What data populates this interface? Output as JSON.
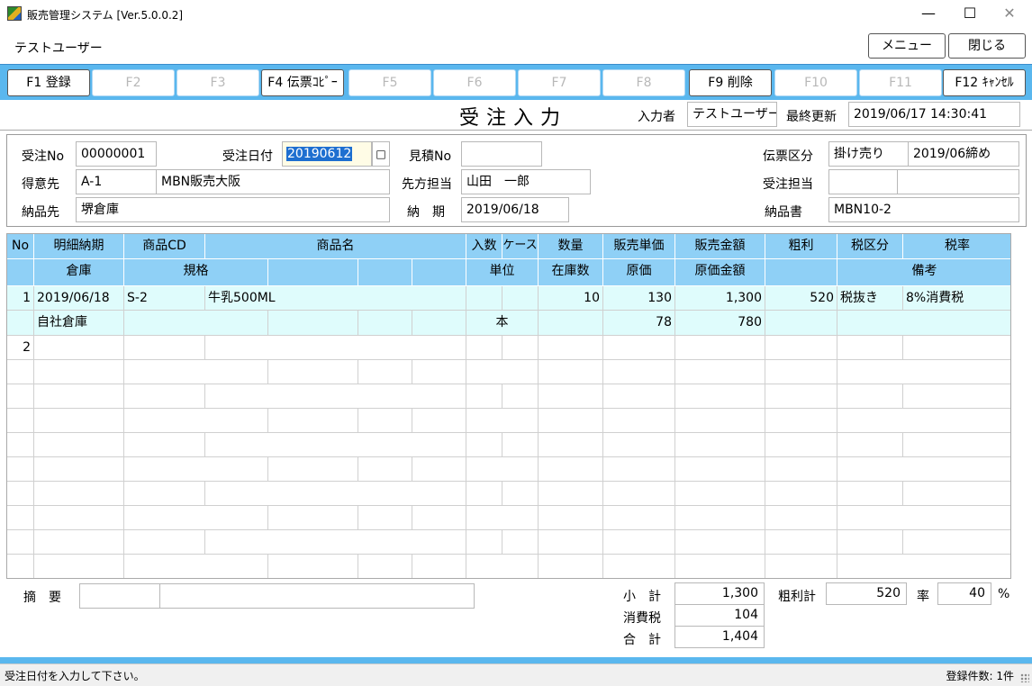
{
  "window": {
    "title": "販売管理システム [Ver.5.0.0.2]",
    "min": "—",
    "max": "☐",
    "close": "✕"
  },
  "user": "テストユーザー",
  "top_buttons": {
    "menu": "メニュー",
    "close": "閉じる"
  },
  "fkeys": [
    {
      "label": "F1 登録",
      "enabled": true
    },
    {
      "label": "F2",
      "enabled": false
    },
    {
      "label": "F3",
      "enabled": false
    },
    {
      "label": "F4 伝票ｺﾋﾟｰ",
      "enabled": true
    },
    {
      "label": "F5",
      "enabled": false
    },
    {
      "label": "F6",
      "enabled": false
    },
    {
      "label": "F7",
      "enabled": false
    },
    {
      "label": "F8",
      "enabled": false
    },
    {
      "label": "F9 削除",
      "enabled": true
    },
    {
      "label": "F10",
      "enabled": false
    },
    {
      "label": "F11",
      "enabled": false
    },
    {
      "label": "F12 ｷｬﾝｾﾙ",
      "enabled": true
    }
  ],
  "form": {
    "title": "受注入力",
    "inputter_label": "入力者",
    "inputter": "テストユーザー",
    "updated_label": "最終更新",
    "updated": "2019/06/17 14:30:41"
  },
  "header": {
    "order_no_label": "受注No",
    "order_no": "00000001",
    "order_date_label": "受注日付",
    "order_date": "20190612",
    "date_btn": "□",
    "quote_no_label": "見積No",
    "quote_no": "",
    "slip_type_label": "伝票区分",
    "slip_type": "掛け売り",
    "closing": "2019/06締め",
    "customer_label": "得意先",
    "customer_code": "A-1",
    "customer_name": "MBN販売大阪",
    "contact_label": "先方担当",
    "contact": "山田　一郎",
    "staff_label": "受注担当",
    "staff_code": "",
    "staff_name": "",
    "delivery_label": "納品先",
    "delivery": "堺倉庫",
    "due_label": "納　期",
    "due": "2019/06/18",
    "delivery_doc_label": "納品書",
    "delivery_doc": "MBN10-2"
  },
  "grid": {
    "head1": [
      "No",
      "明細納期",
      "商品CD",
      "商品名",
      "入数",
      "ケース",
      "数量",
      "販売単価",
      "販売金額",
      "粗利",
      "税区分",
      "税率"
    ],
    "head2": [
      "倉庫",
      "規格",
      "単位",
      "在庫数",
      "原価",
      "原価金額",
      "備考"
    ],
    "rows": [
      {
        "no": "1",
        "due": "2019/06/18",
        "code": "S-2",
        "name": "牛乳500ML",
        "irisu": "",
        "case": "",
        "qty": "10",
        "price": "130",
        "amount": "1,300",
        "profit": "520",
        "tax_type": "税抜き",
        "tax_rate": "8%消費税",
        "warehouse": "自社倉庫",
        "spec": "",
        "unit": "本",
        "stock": "",
        "cost": "78",
        "cost_amount": "780",
        "note": ""
      },
      {
        "no": "2"
      }
    ]
  },
  "footer": {
    "memo_label": "摘　要",
    "memo_code": "",
    "memo_text": "",
    "subtotal_label": "小　計",
    "subtotal": "1,300",
    "tax_label": "消費税",
    "tax": "104",
    "total_label": "合　計",
    "total": "1,404",
    "profit_total_label": "粗利計",
    "profit_total": "520",
    "rate_label": "率",
    "rate": "40",
    "pct": "%"
  },
  "status": {
    "message": "受注日付を入力して下さい。",
    "count": "登録件数: 1件"
  }
}
